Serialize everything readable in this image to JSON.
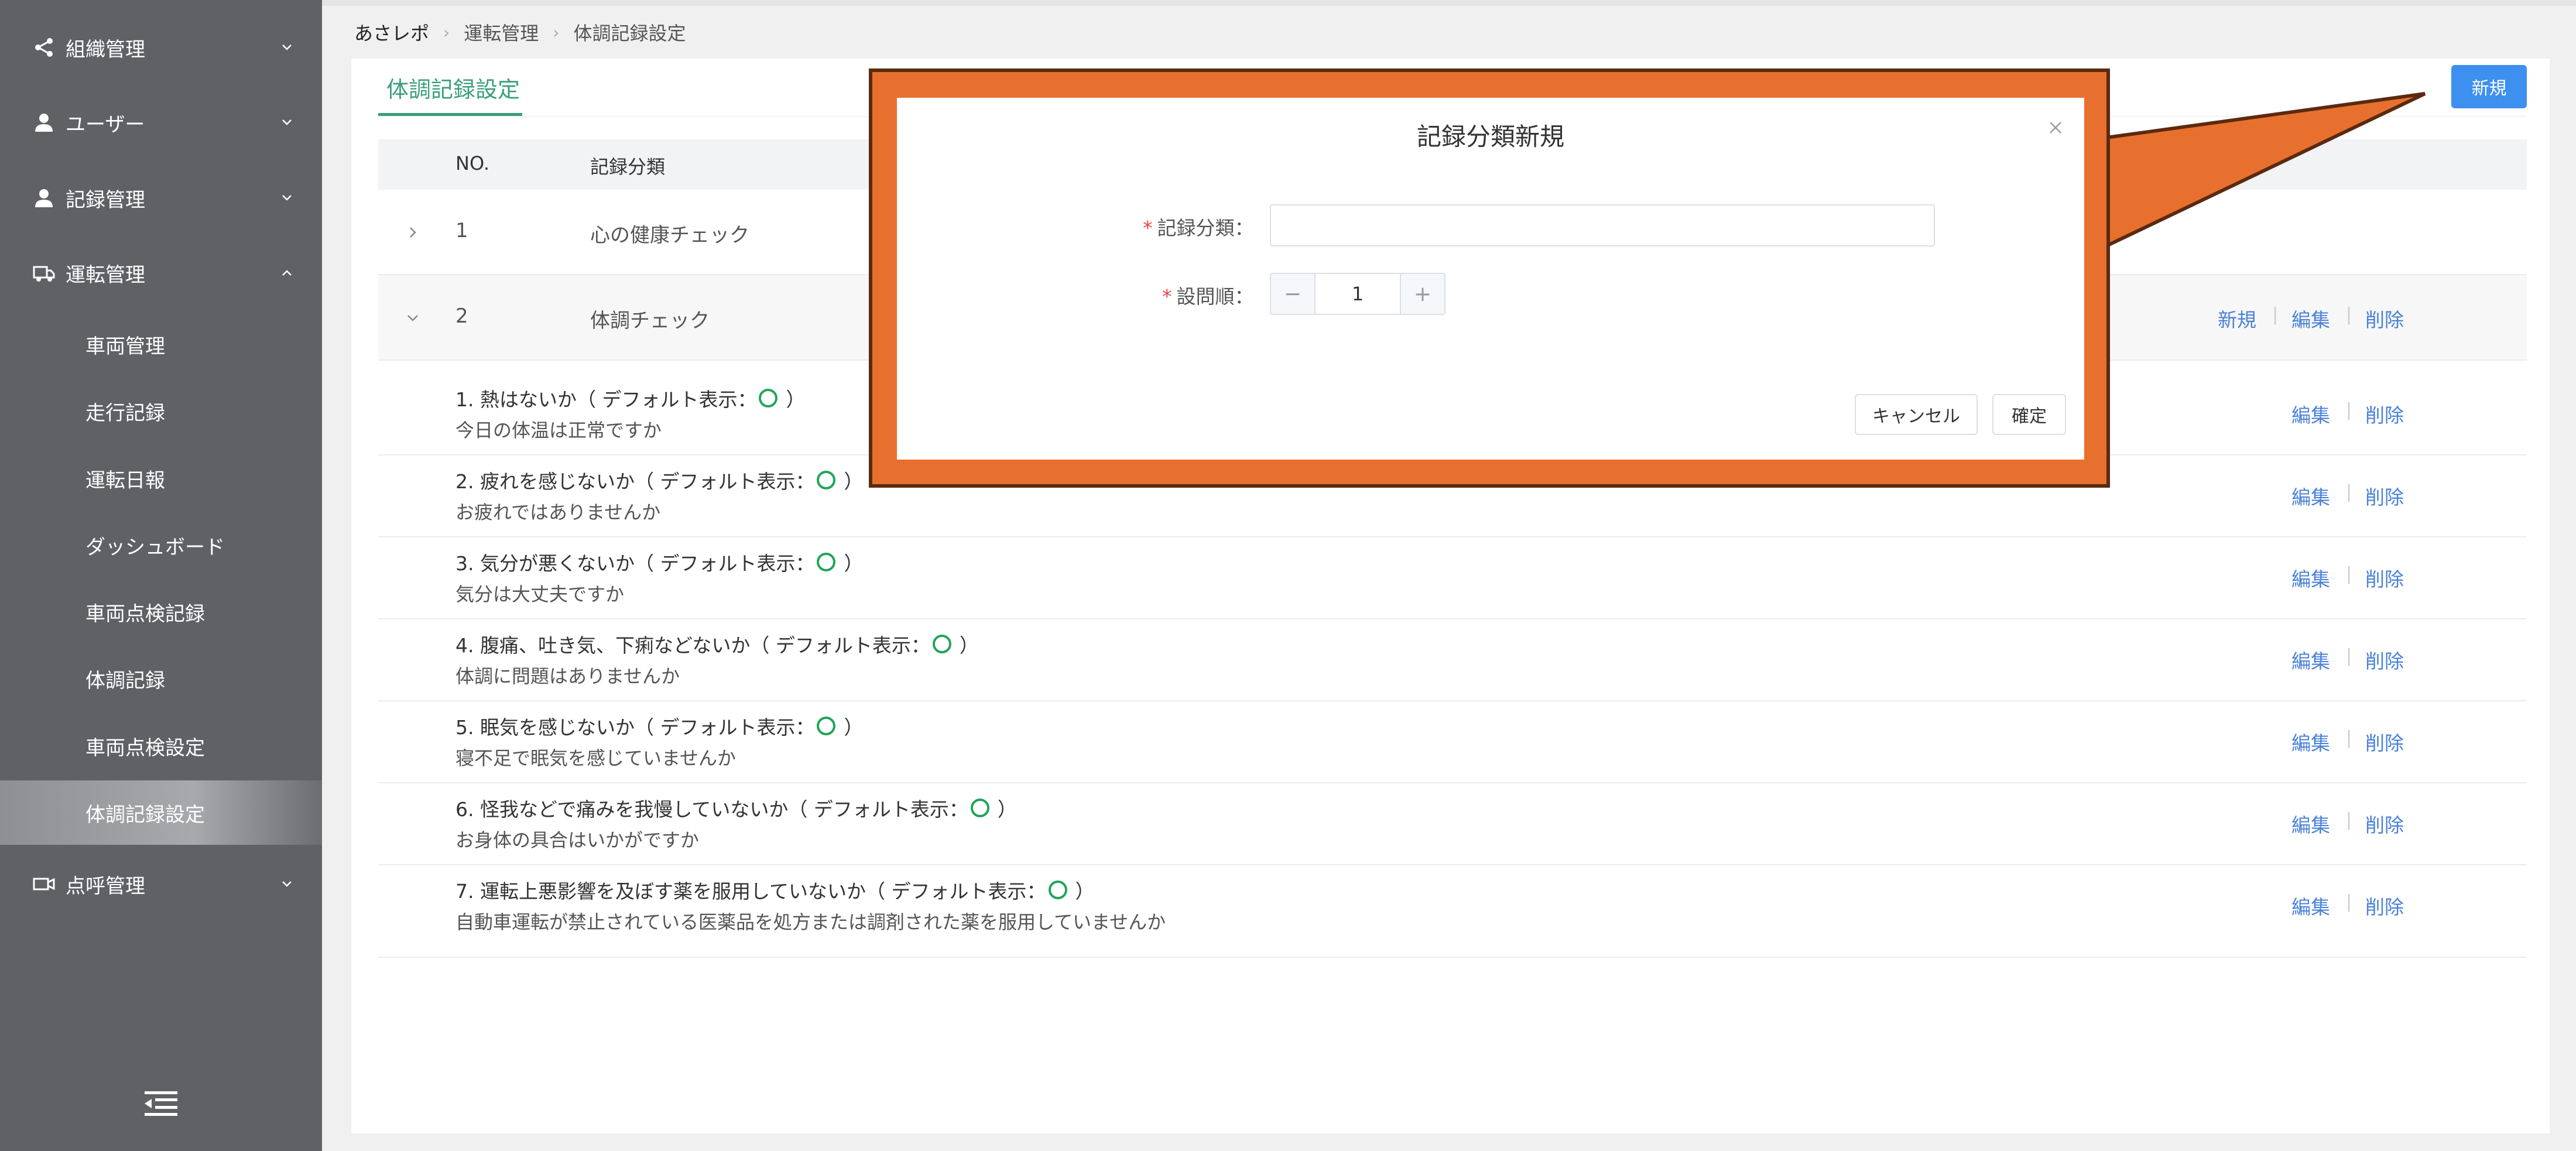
{
  "sidebar": {
    "menus": [
      {
        "label": "組織管理",
        "icon": "share-icon",
        "expanded": false
      },
      {
        "label": "ユーザー",
        "icon": "user-icon",
        "expanded": false
      },
      {
        "label": "記録管理",
        "icon": "user-icon",
        "expanded": false
      },
      {
        "label": "運転管理",
        "icon": "truck-icon",
        "expanded": true
      },
      {
        "label": "点呼管理",
        "icon": "video-icon",
        "expanded": false
      }
    ],
    "submenu": [
      "車両管理",
      "走行記録",
      "運転日報",
      "ダッシュボード",
      "車両点検記録",
      "体調記録",
      "車両点検設定",
      "体調記録設定"
    ],
    "active_submenu": "体調記録設定"
  },
  "breadcrumb": [
    "あさレポ",
    "運転管理",
    "体調記録設定"
  ],
  "page": {
    "tab_title": "体調記録設定",
    "new_button": "新規"
  },
  "table": {
    "headers": {
      "no": "NO.",
      "category": "記録分類"
    },
    "categories": [
      {
        "no": "1",
        "name": "心の健康チェック",
        "expanded": false
      },
      {
        "no": "2",
        "name": "体調チェック",
        "expanded": true
      }
    ],
    "actions": {
      "new": "新規",
      "edit": "編集",
      "delete": "削除",
      "sep": "|"
    },
    "default_prefix": "（ デフォルト表示：",
    "default_suffix": "）",
    "items": [
      {
        "q": "1. 熱はないか",
        "sub": "今日の体温は正常ですか"
      },
      {
        "q": "2. 疲れを感じないか",
        "sub": "お疲れではありませんか"
      },
      {
        "q": "3. 気分が悪くないか",
        "sub": "気分は大丈夫ですか"
      },
      {
        "q": "4. 腹痛、吐き気、下痢などないか",
        "sub": "体調に問題はありませんか"
      },
      {
        "q": "5. 眠気を感じないか",
        "sub": "寝不足で眠気を感じていませんか"
      },
      {
        "q": "6. 怪我などで痛みを我慢していないか",
        "sub": "お身体の具合はいかがですか"
      },
      {
        "q": "7. 運転上悪影響を及ぼす薬を服用していないか",
        "sub": "自動車運転が禁止されている医薬品を処方または調剤された薬を服用していませんか"
      }
    ]
  },
  "modal": {
    "title": "記録分類新規",
    "field_category_label": "記録分類：",
    "field_category_value": "",
    "field_order_label": "設問順：",
    "field_order_value": "1",
    "required_mark": "*",
    "stepper_minus": "−",
    "stepper_plus": "+",
    "cancel_button": "キャンセル",
    "confirm_button": "確定"
  },
  "colors": {
    "sidebar_bg": "#5f6165",
    "accent_green": "#3a9e7e",
    "primary_blue": "#3d8ff0",
    "link_blue": "#4a82d8",
    "highlight_orange": "#e8702e"
  }
}
